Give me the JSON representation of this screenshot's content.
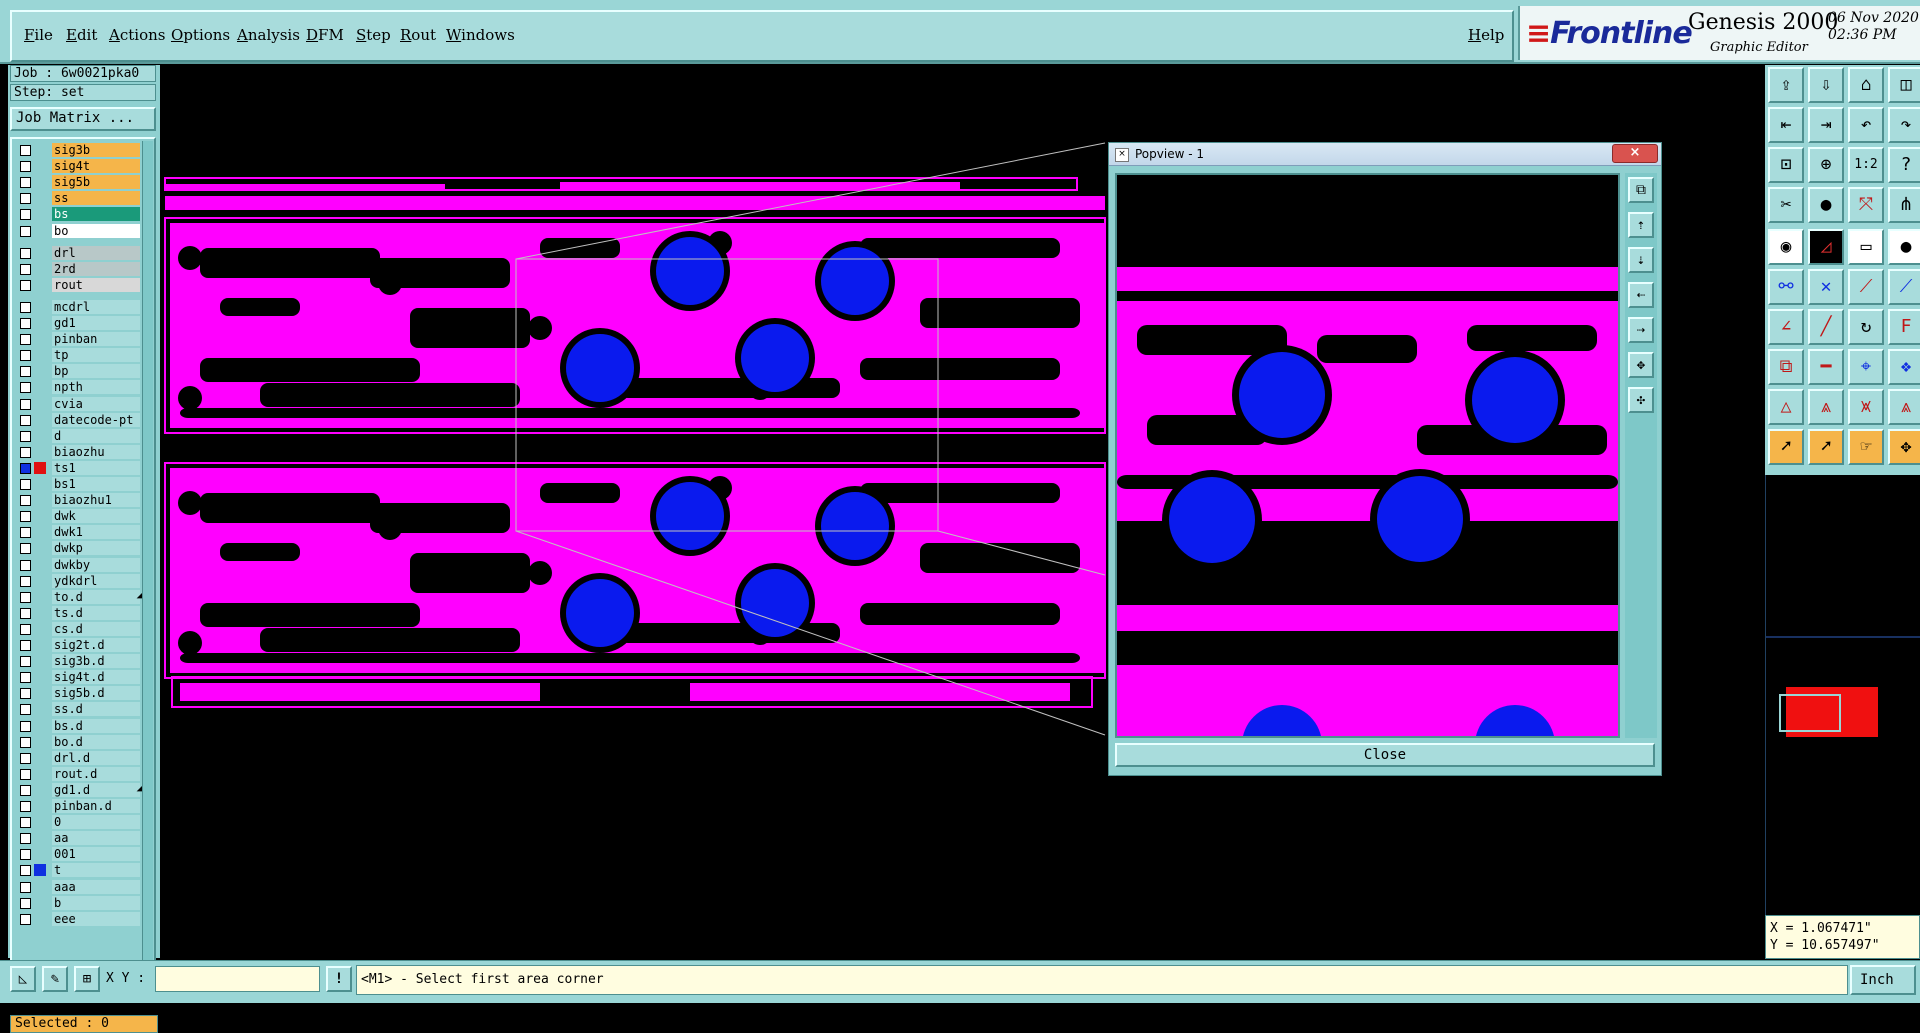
{
  "menu": {
    "items": [
      "File",
      "Edit",
      "Actions",
      "Options",
      "Analysis",
      "DFM",
      "Step",
      "Rout",
      "Windows"
    ],
    "help": "Help"
  },
  "brand": {
    "logo_main": "Frontline",
    "product": "Genesis 2000",
    "subtitle": "Graphic Editor",
    "date": "06 Nov 2020",
    "time": "02:36 PM"
  },
  "job": {
    "job_text": "Job : 6w0021pka0",
    "step_text": "Step: set",
    "matrix_button": "Job Matrix ..."
  },
  "layers": [
    {
      "name": "sig3b",
      "color": "#f5b54a"
    },
    {
      "name": "sig4t",
      "color": "#f5b54a"
    },
    {
      "name": "sig5b",
      "color": "#f5b54a"
    },
    {
      "name": "ss",
      "color": "#f5b54a"
    },
    {
      "name": "bs",
      "color": "#1a9a7a"
    },
    {
      "name": "bo",
      "color": "#ffffff"
    },
    {
      "name": "drl",
      "color": "#b8c8c8"
    },
    {
      "name": "2rd",
      "color": "#b8c8c8"
    },
    {
      "name": "rout",
      "color": "#d8d8d8"
    },
    {
      "name": "mcdrl",
      "color": "#a8dcdc"
    },
    {
      "name": "gd1",
      "color": "#a8dcdc"
    },
    {
      "name": "pinban",
      "color": "#a8dcdc"
    },
    {
      "name": "tp",
      "color": "#a8dcdc"
    },
    {
      "name": "bp",
      "color": "#a8dcdc"
    },
    {
      "name": "npth",
      "color": "#a8dcdc"
    },
    {
      "name": "cvia",
      "color": "#a8dcdc"
    },
    {
      "name": "datecode-pt",
      "color": "#a8dcdc"
    },
    {
      "name": "d",
      "color": "#a8dcdc"
    },
    {
      "name": "biaozhu",
      "color": "#a8dcdc"
    },
    {
      "name": "ts1",
      "color": "#a8dcdc",
      "swatch": "#e01010",
      "active": true
    },
    {
      "name": "bs1",
      "color": "#a8dcdc"
    },
    {
      "name": "biaozhu1",
      "color": "#a8dcdc"
    },
    {
      "name": "dwk",
      "color": "#a8dcdc"
    },
    {
      "name": "dwk1",
      "color": "#a8dcdc"
    },
    {
      "name": "dwkp",
      "color": "#a8dcdc"
    },
    {
      "name": "dwkby",
      "color": "#a8dcdc"
    },
    {
      "name": "ydkdrl",
      "color": "#a8dcdc"
    },
    {
      "name": "to.d",
      "color": "#a8dcdc",
      "mark": "◢"
    },
    {
      "name": "ts.d",
      "color": "#a8dcdc"
    },
    {
      "name": "cs.d",
      "color": "#a8dcdc"
    },
    {
      "name": "sig2t.d",
      "color": "#a8dcdc"
    },
    {
      "name": "sig3b.d",
      "color": "#a8dcdc"
    },
    {
      "name": "sig4t.d",
      "color": "#a8dcdc"
    },
    {
      "name": "sig5b.d",
      "color": "#a8dcdc"
    },
    {
      "name": "ss.d",
      "color": "#a8dcdc"
    },
    {
      "name": "bs.d",
      "color": "#a8dcdc"
    },
    {
      "name": "bo.d",
      "color": "#a8dcdc"
    },
    {
      "name": "drl.d",
      "color": "#a8dcdc"
    },
    {
      "name": "rout.d",
      "color": "#a8dcdc"
    },
    {
      "name": "gd1.d",
      "color": "#a8dcdc",
      "mark": "◢"
    },
    {
      "name": "pinban.d",
      "color": "#a8dcdc"
    },
    {
      "name": "0",
      "color": "#a8dcdc"
    },
    {
      "name": "aa",
      "color": "#a8dcdc"
    },
    {
      "name": "001",
      "color": "#a8dcdc"
    },
    {
      "name": "t",
      "color": "#a8dcdc",
      "swatch": "#1030e0"
    },
    {
      "name": "aaa",
      "color": "#a8dcdc"
    },
    {
      "name": "b",
      "color": "#a8dcdc"
    },
    {
      "name": "eee",
      "color": "#a8dcdc"
    }
  ],
  "selected_text": "Selected : 0",
  "popview": {
    "title": "Popview - 1",
    "close_label": "Close",
    "close_x": "×"
  },
  "coords": {
    "x_text": "X = 1.067471\"",
    "y_text": "Y = 10.657497\""
  },
  "status": {
    "xy_label": "X Y :",
    "xy_value": "",
    "message": "<M1> - Select first area corner",
    "units": "Inch"
  },
  "colors": {
    "copper": "#ff00ff",
    "pad": "#0a1aee",
    "panel_bg": "#9ad6d6",
    "highlight": "#f5b54a",
    "active_layer": "#e01010"
  }
}
